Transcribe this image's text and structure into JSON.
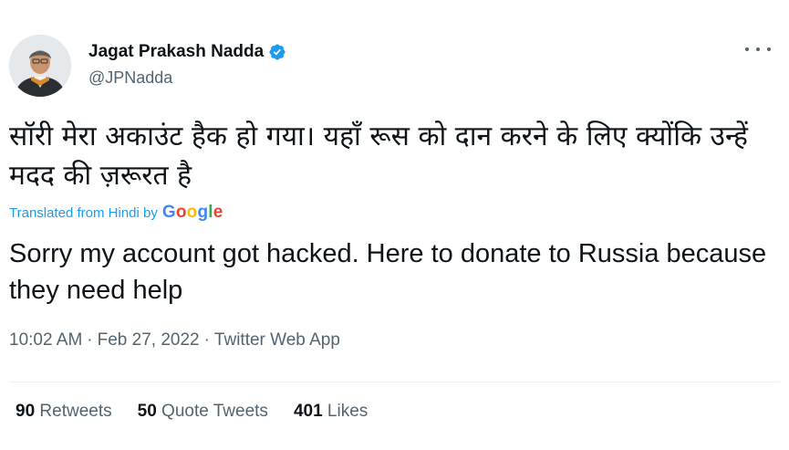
{
  "author": {
    "name": "Jagat Prakash Nadda",
    "handle": "@JPNadda",
    "verified": true
  },
  "tweet": {
    "original_text": "सॉरी मेरा अकाउंट हैक हो गया। यहाँ रूस को दान करने के लिए क्योंकि उन्हें मदद की ज़रूरत है",
    "translated_from": "Translated from Hindi by",
    "translator": "Google",
    "translation": "Sorry my account got hacked. Here to donate to Russia because they need help",
    "time": "10:02 AM",
    "date": "Feb 27, 2022",
    "source": "Twitter Web App"
  },
  "stats": {
    "retweets_count": "90",
    "retweets_label": "Retweets",
    "quotes_count": "50",
    "quotes_label": "Quote Tweets",
    "likes_count": "401",
    "likes_label": "Likes"
  },
  "colors": {
    "link": "#1d9bf0",
    "secondary_text": "#536471",
    "primary_text": "#0f1419"
  },
  "icons": [
    "avatar",
    "verified-badge-icon",
    "more-options-icon"
  ]
}
